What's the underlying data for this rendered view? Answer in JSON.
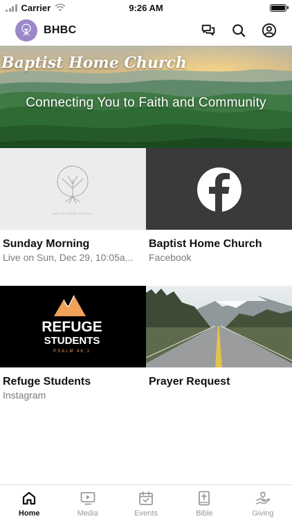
{
  "status_bar": {
    "carrier": "Carrier",
    "time": "9:26 AM"
  },
  "header": {
    "brand": "BHBC",
    "icons": [
      "chat-icon",
      "search-icon",
      "profile-icon"
    ]
  },
  "hero": {
    "title": "Baptist Home Church",
    "tagline": "Connecting You to Faith and Community"
  },
  "tiles": [
    {
      "title": "Sunday Morning",
      "subtitle": "Live on Sun, Dec 29, 10:05a...",
      "thumb_caption": "BAPTIST HOME CHURCH"
    },
    {
      "title": "Baptist Home Church",
      "subtitle": "Facebook"
    },
    {
      "title": "Refuge Students",
      "subtitle": "Instagram",
      "thumb_line1": "REFUGE",
      "thumb_line2": "STUDENTS",
      "thumb_line3": "PSALM 46:1"
    },
    {
      "title": "Prayer Request",
      "subtitle": ""
    }
  ],
  "tabbar": {
    "active": "Home",
    "items": [
      {
        "label": "Home",
        "icon": "home-icon"
      },
      {
        "label": "Media",
        "icon": "media-icon"
      },
      {
        "label": "Events",
        "icon": "calendar-icon"
      },
      {
        "label": "Bible",
        "icon": "bible-icon"
      },
      {
        "label": "Giving",
        "icon": "giving-icon"
      }
    ]
  },
  "colors": {
    "accent": "#111111",
    "inactive": "#9a9a9a",
    "avatar_bg": "#9a88c9",
    "facebook_tile_bg": "#3a3a3a",
    "refuge_orange": "#f0a15a"
  }
}
